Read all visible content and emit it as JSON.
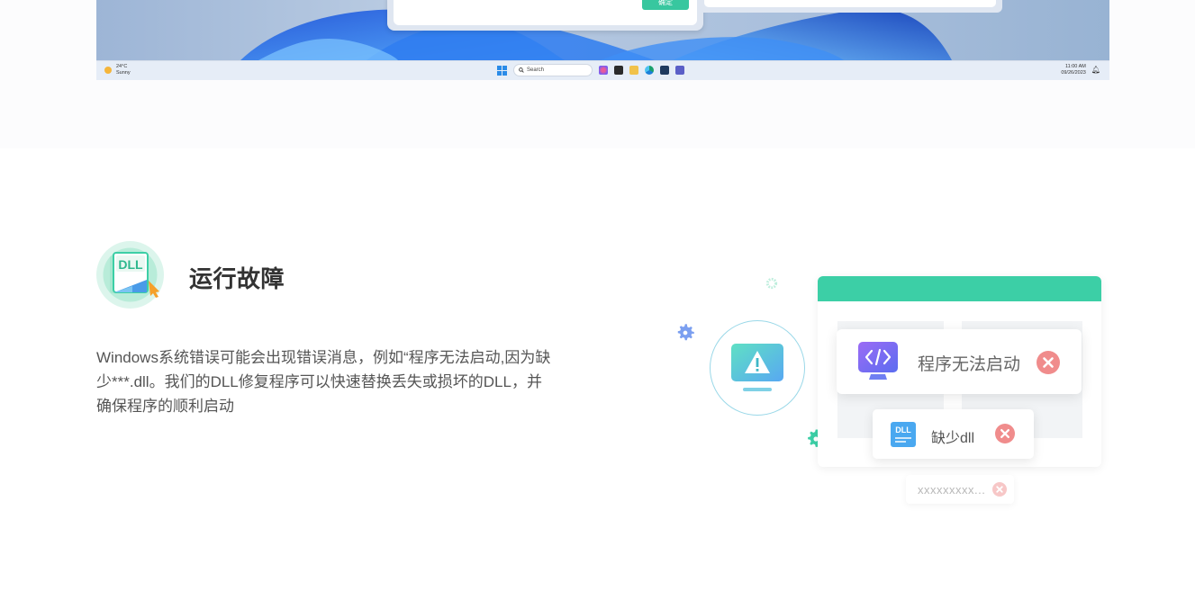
{
  "screenshot": {
    "dialog_ok_label": "确定",
    "weather": {
      "temp": "24°C",
      "condition": "Sunny"
    },
    "taskbar": {
      "search_placeholder": "Search",
      "time": "11:00 AM",
      "date": "09/26/2023"
    }
  },
  "feature": {
    "icon_label": "DLL",
    "title": "运行故障",
    "description": "Windows系统错误可能会出现错误消息，例如“程序无法启动,因为缺少***.dll。我们的DLL修复程序可以快速替换丢失或损坏的DLL，并确保程序的顺利启动"
  },
  "illustration": {
    "error_card_text": "程序无法启动",
    "dll_icon_label": "DLL",
    "dll_card_text": "缺少dll",
    "placeholder_card_text": "xxxxxxxxx..."
  },
  "colors": {
    "accent_green": "#3ccfa6",
    "error_red": "#f08c8c",
    "gear_blue": "#7b9ff0",
    "title_text": "#333333",
    "body_text": "#555555"
  }
}
